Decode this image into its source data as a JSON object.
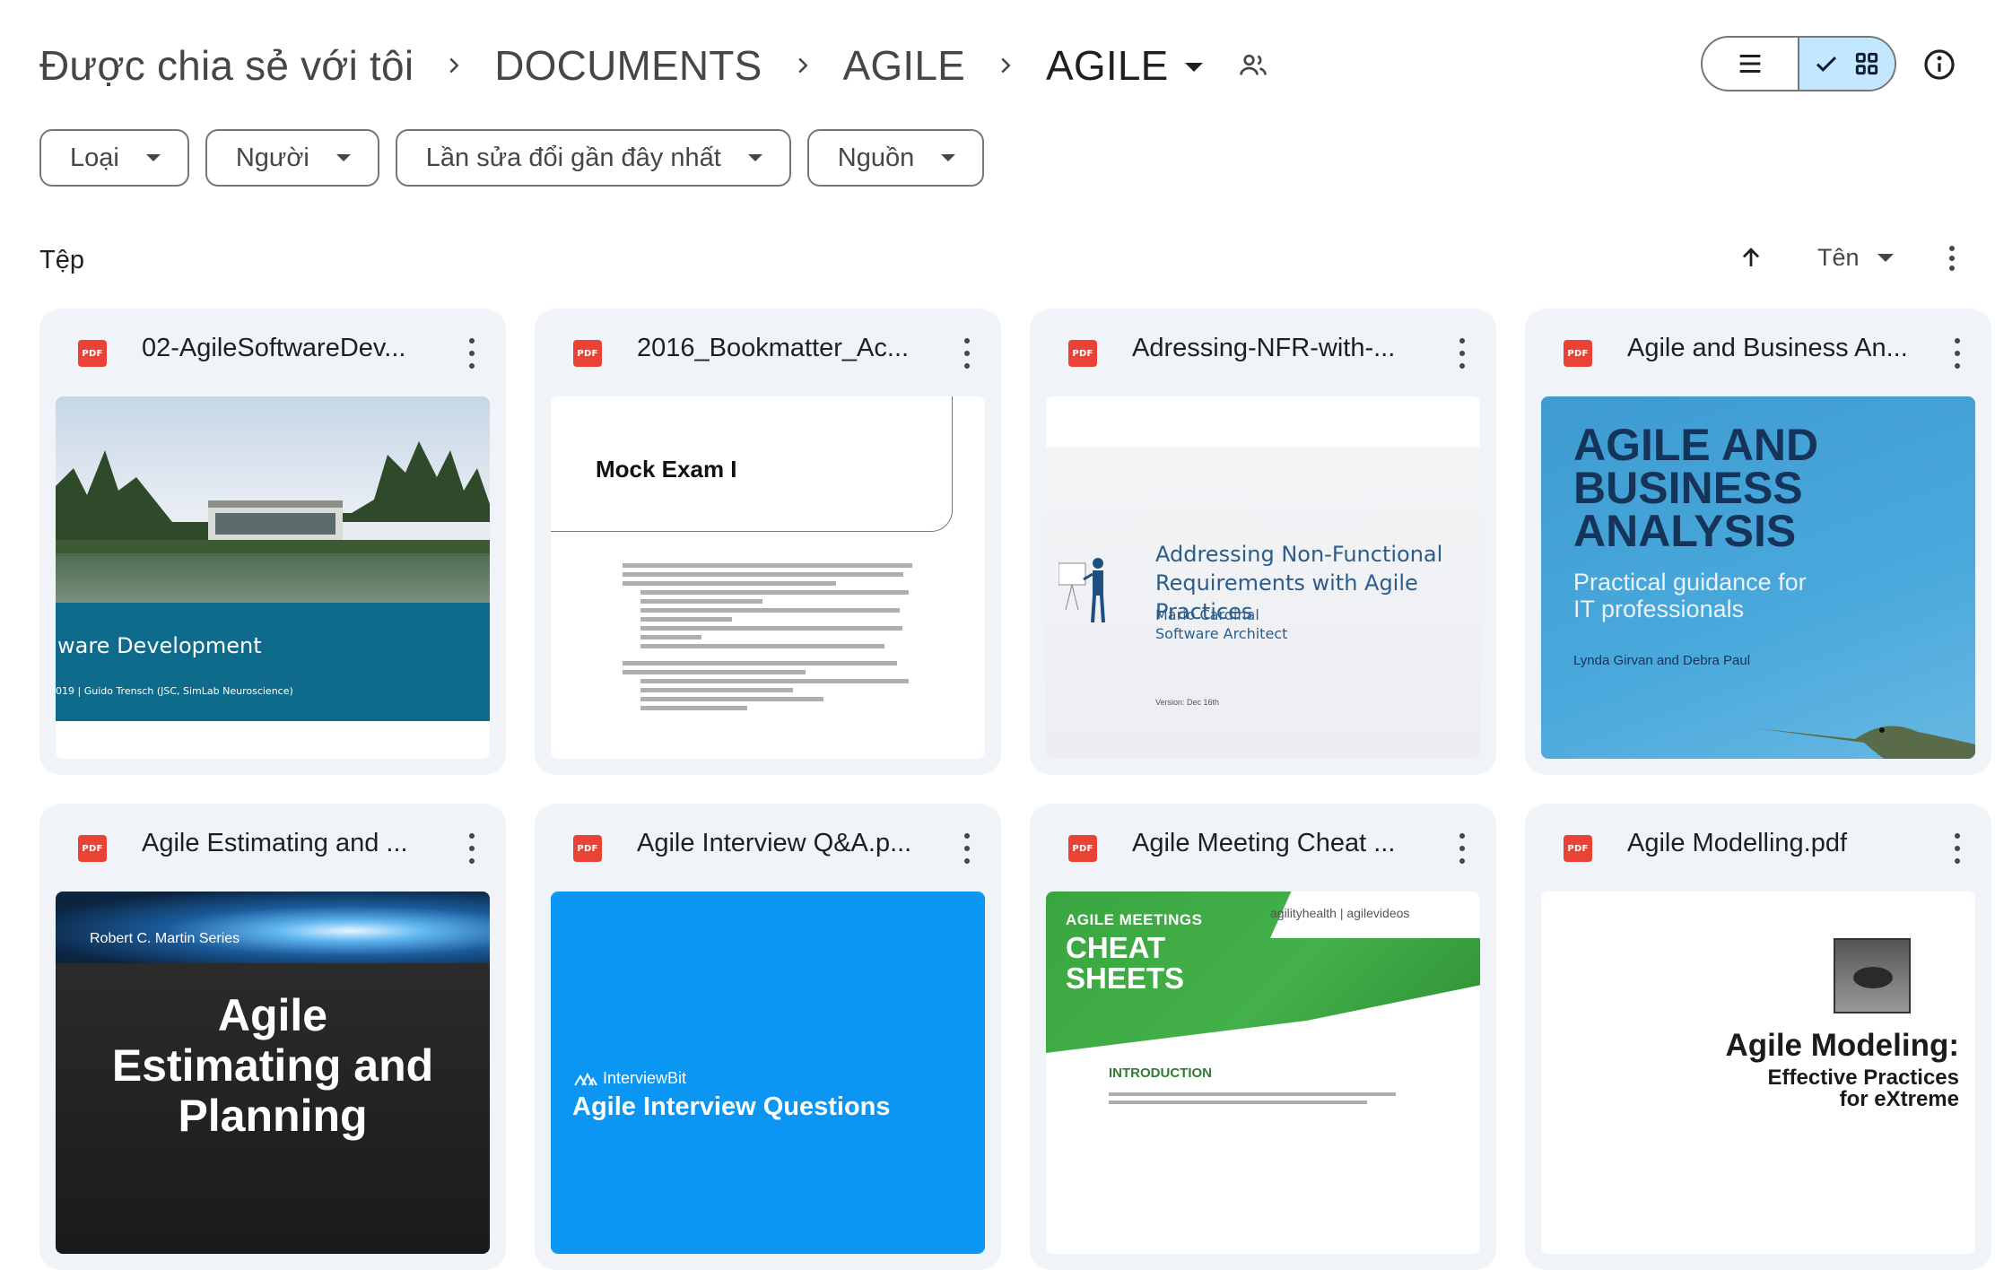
{
  "breadcrumb": {
    "items": [
      "Được chia sẻ với tôi",
      "DOCUMENTS",
      "AGILE"
    ],
    "current": "AGILE"
  },
  "filters": [
    "Loại",
    "Người",
    "Lần sửa đổi gần đây nhất",
    "Nguồn"
  ],
  "section": {
    "title": "Tệp",
    "sort_label": "Tên"
  },
  "icons": {
    "share": "people-icon",
    "list_view": "list-icon",
    "grid_view": "grid-icon",
    "checked": "check-icon",
    "info": "info-icon",
    "file_type": "pdf-icon",
    "sort_direction": "arrow-up-icon",
    "more": "more-vert-icon"
  },
  "colors": {
    "card_bg": "#f0f4f9",
    "active_toggle": "#c2e7ff",
    "pdf_red": "#ea4335"
  },
  "files": [
    {
      "name": "02-AgileSoftwareDev...",
      "type_badge": "PDF",
      "thumb": {
        "heading": "ware Development",
        "sub": "019 | Guido Trensch  (JSC, SimLab Neuroscience)"
      }
    },
    {
      "name": "2016_Bookmatter_Ac...",
      "type_badge": "PDF",
      "thumb": {
        "heading": "Mock Exam I"
      }
    },
    {
      "name": "Adressing-NFR-with-...",
      "type_badge": "PDF",
      "thumb": {
        "heading": "Addressing Non-Functional Requirements with Agile Practices",
        "author": "Mario Cardinal",
        "role": "Software Architect",
        "version": "Version: Dec 16th"
      }
    },
    {
      "name": "Agile and Business An...",
      "type_badge": "PDF",
      "thumb": {
        "heading": "AGILE AND BUSINESS ANALYSIS",
        "sub": "Practical guidance for IT professionals",
        "authors": "Lynda Girvan and Debra Paul"
      }
    },
    {
      "name": "Agile Estimating and ...",
      "type_badge": "PDF",
      "thumb": {
        "series": "Robert C. Martin Series",
        "heading": "Agile Estimating and Planning"
      }
    },
    {
      "name": "Agile Interview Q&A.p...",
      "type_badge": "PDF",
      "thumb": {
        "brand": "InterviewBit",
        "heading": "Agile Interview Questions"
      }
    },
    {
      "name": "Agile Meeting Cheat ...",
      "type_badge": "PDF",
      "thumb": {
        "small": "AGILE MEETINGS",
        "heading": "CHEAT SHEETS",
        "brand": "agilityhealth | agilevideos",
        "intro": "INTRODUCTION"
      }
    },
    {
      "name": "Agile Modelling.pdf",
      "type_badge": "PDF",
      "thumb": {
        "heading": "Agile Modeling:",
        "sub1": "Effective Practices",
        "sub2": "for eXtreme"
      }
    }
  ]
}
